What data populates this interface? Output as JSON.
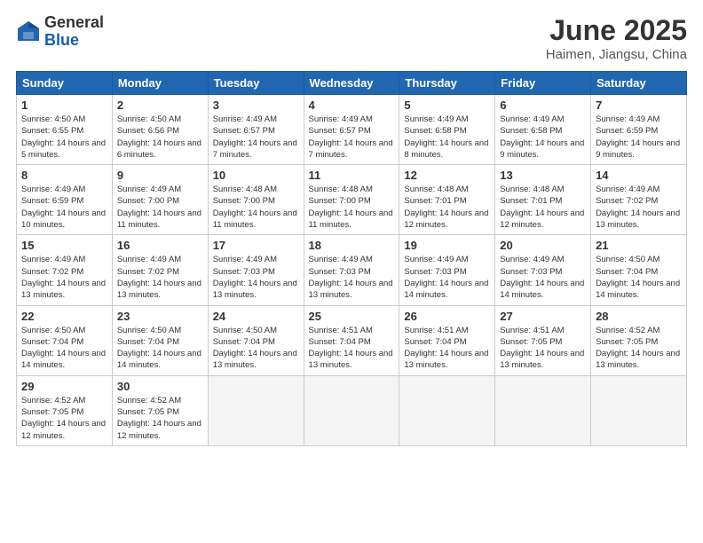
{
  "logo": {
    "general": "General",
    "blue": "Blue"
  },
  "header": {
    "title": "June 2025",
    "subtitle": "Haimen, Jiangsu, China"
  },
  "weekdays": [
    "Sunday",
    "Monday",
    "Tuesday",
    "Wednesday",
    "Thursday",
    "Friday",
    "Saturday"
  ],
  "weeks": [
    [
      {
        "day": "1",
        "sunrise": "4:50 AM",
        "sunset": "6:55 PM",
        "daylight": "14 hours and 5 minutes."
      },
      {
        "day": "2",
        "sunrise": "4:50 AM",
        "sunset": "6:56 PM",
        "daylight": "14 hours and 6 minutes."
      },
      {
        "day": "3",
        "sunrise": "4:49 AM",
        "sunset": "6:57 PM",
        "daylight": "14 hours and 7 minutes."
      },
      {
        "day": "4",
        "sunrise": "4:49 AM",
        "sunset": "6:57 PM",
        "daylight": "14 hours and 7 minutes."
      },
      {
        "day": "5",
        "sunrise": "4:49 AM",
        "sunset": "6:58 PM",
        "daylight": "14 hours and 8 minutes."
      },
      {
        "day": "6",
        "sunrise": "4:49 AM",
        "sunset": "6:58 PM",
        "daylight": "14 hours and 9 minutes."
      },
      {
        "day": "7",
        "sunrise": "4:49 AM",
        "sunset": "6:59 PM",
        "daylight": "14 hours and 9 minutes."
      }
    ],
    [
      {
        "day": "8",
        "sunrise": "4:49 AM",
        "sunset": "6:59 PM",
        "daylight": "14 hours and 10 minutes."
      },
      {
        "day": "9",
        "sunrise": "4:49 AM",
        "sunset": "7:00 PM",
        "daylight": "14 hours and 11 minutes."
      },
      {
        "day": "10",
        "sunrise": "4:48 AM",
        "sunset": "7:00 PM",
        "daylight": "14 hours and 11 minutes."
      },
      {
        "day": "11",
        "sunrise": "4:48 AM",
        "sunset": "7:00 PM",
        "daylight": "14 hours and 11 minutes."
      },
      {
        "day": "12",
        "sunrise": "4:48 AM",
        "sunset": "7:01 PM",
        "daylight": "14 hours and 12 minutes."
      },
      {
        "day": "13",
        "sunrise": "4:48 AM",
        "sunset": "7:01 PM",
        "daylight": "14 hours and 12 minutes."
      },
      {
        "day": "14",
        "sunrise": "4:49 AM",
        "sunset": "7:02 PM",
        "daylight": "14 hours and 13 minutes."
      }
    ],
    [
      {
        "day": "15",
        "sunrise": "4:49 AM",
        "sunset": "7:02 PM",
        "daylight": "14 hours and 13 minutes."
      },
      {
        "day": "16",
        "sunrise": "4:49 AM",
        "sunset": "7:02 PM",
        "daylight": "14 hours and 13 minutes."
      },
      {
        "day": "17",
        "sunrise": "4:49 AM",
        "sunset": "7:03 PM",
        "daylight": "14 hours and 13 minutes."
      },
      {
        "day": "18",
        "sunrise": "4:49 AM",
        "sunset": "7:03 PM",
        "daylight": "14 hours and 13 minutes."
      },
      {
        "day": "19",
        "sunrise": "4:49 AM",
        "sunset": "7:03 PM",
        "daylight": "14 hours and 14 minutes."
      },
      {
        "day": "20",
        "sunrise": "4:49 AM",
        "sunset": "7:03 PM",
        "daylight": "14 hours and 14 minutes."
      },
      {
        "day": "21",
        "sunrise": "4:50 AM",
        "sunset": "7:04 PM",
        "daylight": "14 hours and 14 minutes."
      }
    ],
    [
      {
        "day": "22",
        "sunrise": "4:50 AM",
        "sunset": "7:04 PM",
        "daylight": "14 hours and 14 minutes."
      },
      {
        "day": "23",
        "sunrise": "4:50 AM",
        "sunset": "7:04 PM",
        "daylight": "14 hours and 14 minutes."
      },
      {
        "day": "24",
        "sunrise": "4:50 AM",
        "sunset": "7:04 PM",
        "daylight": "14 hours and 13 minutes."
      },
      {
        "day": "25",
        "sunrise": "4:51 AM",
        "sunset": "7:04 PM",
        "daylight": "14 hours and 13 minutes."
      },
      {
        "day": "26",
        "sunrise": "4:51 AM",
        "sunset": "7:04 PM",
        "daylight": "14 hours and 13 minutes."
      },
      {
        "day": "27",
        "sunrise": "4:51 AM",
        "sunset": "7:05 PM",
        "daylight": "14 hours and 13 minutes."
      },
      {
        "day": "28",
        "sunrise": "4:52 AM",
        "sunset": "7:05 PM",
        "daylight": "14 hours and 13 minutes."
      }
    ],
    [
      {
        "day": "29",
        "sunrise": "4:52 AM",
        "sunset": "7:05 PM",
        "daylight": "14 hours and 12 minutes."
      },
      {
        "day": "30",
        "sunrise": "4:52 AM",
        "sunset": "7:05 PM",
        "daylight": "14 hours and 12 minutes."
      },
      null,
      null,
      null,
      null,
      null
    ]
  ]
}
